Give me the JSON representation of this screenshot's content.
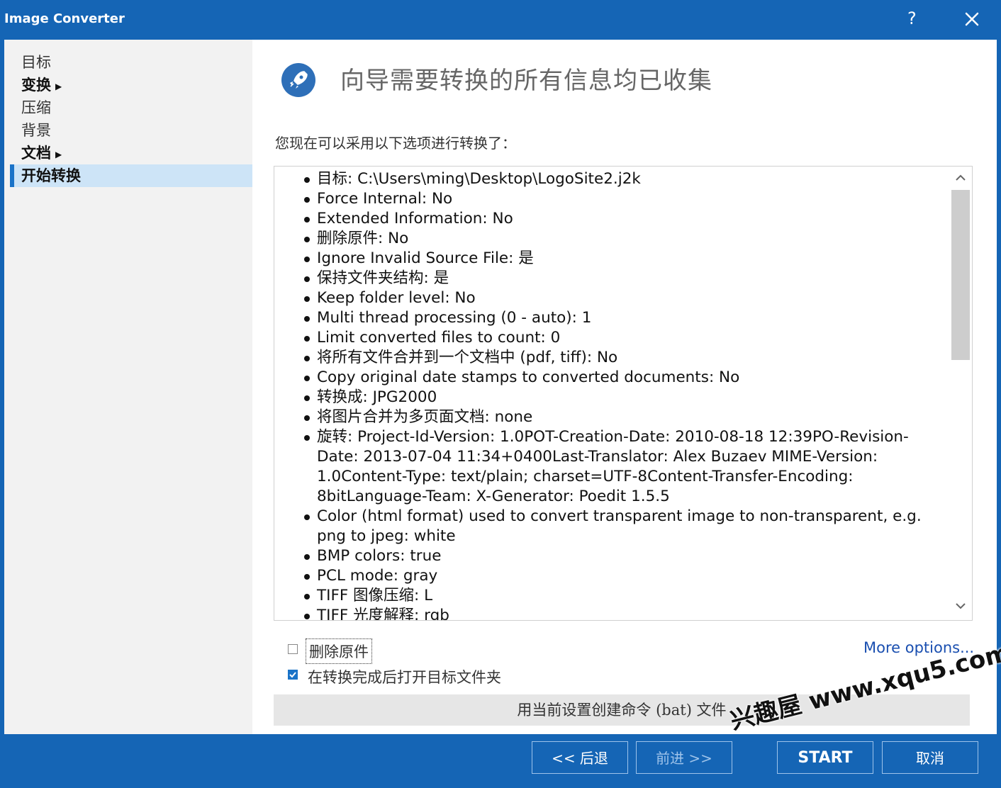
{
  "window": {
    "title": "Image Converter",
    "help": "?"
  },
  "sidebar": {
    "items": [
      {
        "label": "目标",
        "bold": false,
        "arrow": false,
        "active": false
      },
      {
        "label": "变换",
        "bold": true,
        "arrow": true,
        "active": false
      },
      {
        "label": "压缩",
        "bold": false,
        "arrow": false,
        "active": false
      },
      {
        "label": "背景",
        "bold": false,
        "arrow": false,
        "active": false
      },
      {
        "label": "文档",
        "bold": true,
        "arrow": true,
        "active": false
      },
      {
        "label": "开始转换",
        "bold": false,
        "arrow": false,
        "active": true
      }
    ]
  },
  "main": {
    "heading": "向导需要转换的所有信息均已收集",
    "subtitle": "您现在可以采用以下选项进行转换了：",
    "summary": [
      "目标: C:\\Users\\ming\\Desktop\\LogoSite2.j2k",
      "Force Internal: No",
      "Extended Information: No",
      "删除原件: No",
      "Ignore Invalid Source File: 是",
      "保持文件夹结构: 是",
      "Keep folder level: No",
      "Multi thread processing (0 - auto): 1",
      "Limit converted files to count: 0",
      "将所有文件合并到一个文档中 (pdf, tiff): No",
      "Copy original date stamps to converted documents: No",
      "转换成: JPG2000",
      "将图片合并为多页面文档: none",
      "旋转: Project-Id-Version: 1.0POT-Creation-Date: 2010-08-18 12:39PO-Revision-Date: 2013-07-04 11:34+0400Last-Translator: Alex Buzaev MIME-Version: 1.0Content-Type: text/plain; charset=UTF-8Content-Transfer-Encoding: 8bitLanguage-Team: X-Generator: Poedit 1.5.5",
      "Color (html format) used to convert transparent image to non-transparent, e.g. png to jpeg: white",
      "BMP colors: true",
      "PCL mode: gray",
      "TIFF 图像压缩: L",
      "TIFF 光度解释: rgb"
    ],
    "delete_original": {
      "label": "删除原件",
      "checked": false
    },
    "open_folder": {
      "label": "在转换完成后打开目标文件夹",
      "checked": true
    },
    "more_options": "More options...",
    "bat_button": "用当前设置创建命令 (bat) 文件"
  },
  "footer": {
    "back": "<< 后退",
    "next": "前进 >>",
    "start": "START",
    "cancel": "取消"
  },
  "watermark": "兴趣屋 www.xqu5.com",
  "colors": {
    "titlebar": "#1565b5",
    "accent": "#1a73c8",
    "sidebar_bg": "#f2f2f2",
    "active_item": "#cde4f7"
  }
}
